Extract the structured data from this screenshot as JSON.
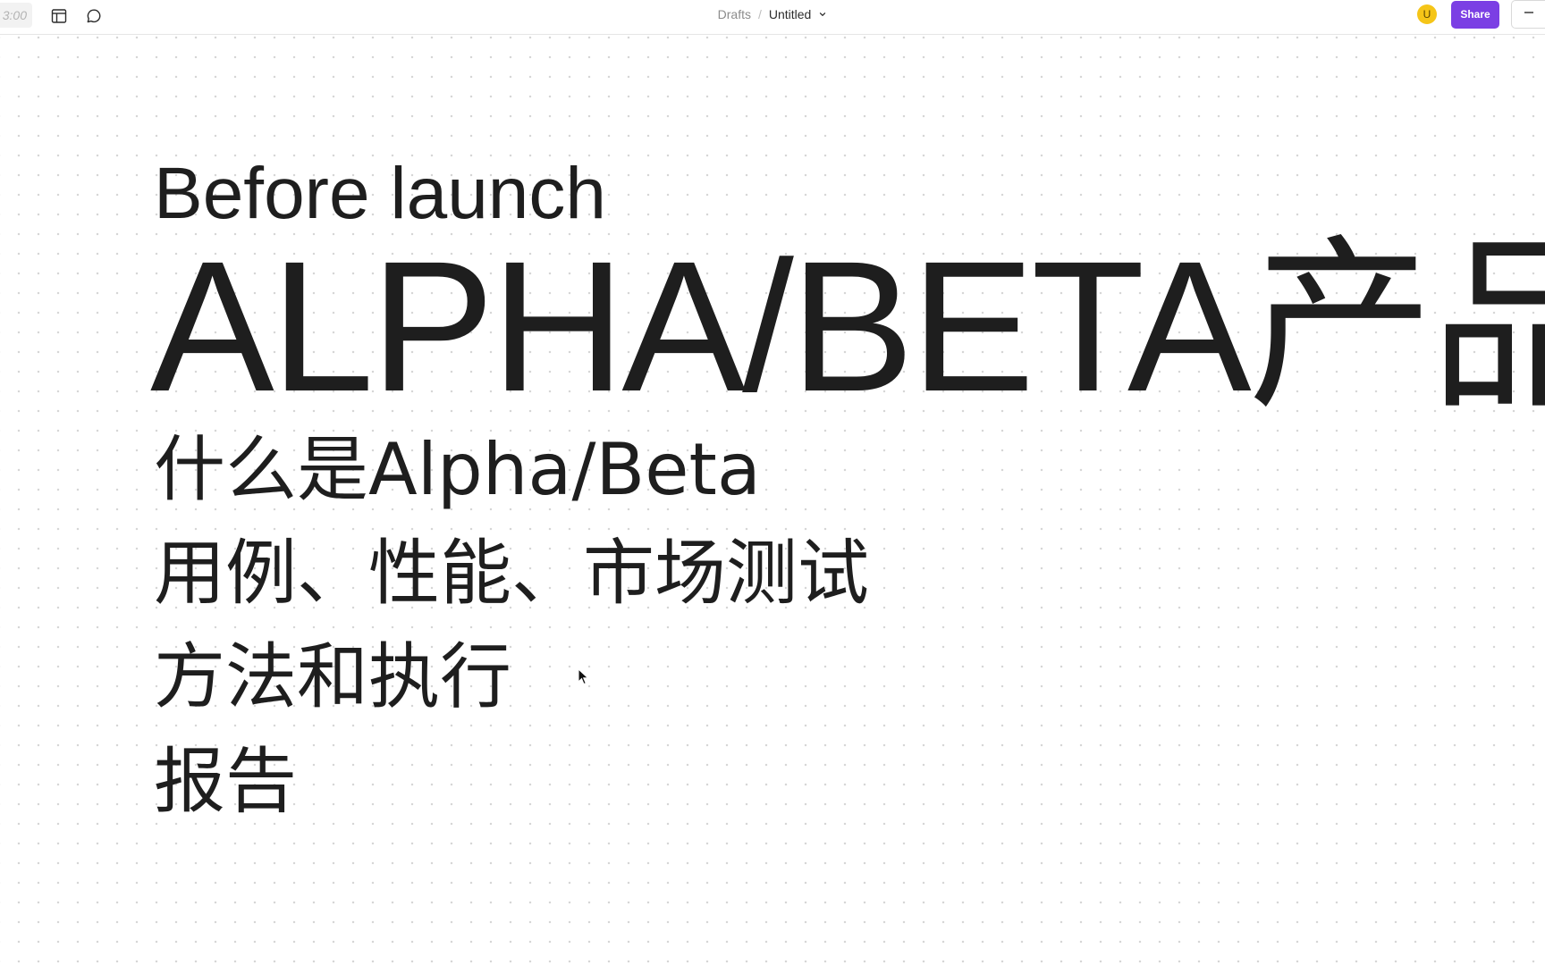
{
  "toolbar": {
    "timer": "3:00",
    "layout_icon": "layout-icon",
    "comment_icon": "comment-icon"
  },
  "breadcrumb": {
    "parent": "Drafts",
    "separator": "/",
    "title": "Untitled",
    "chevron_icon": "chevron-down-icon"
  },
  "user": {
    "avatar_initial": "U",
    "avatar_color": "#f5c518"
  },
  "share": {
    "label": "Share",
    "color": "#7b3fe4"
  },
  "zoom": {
    "icon": "minus-icon"
  },
  "canvas": {
    "heading_small": "Before launch",
    "heading_large": "ALPHA/BETA产品",
    "items": [
      "什么是Alpha/Beta",
      "用例、性能、市场测试",
      "方法和执行",
      "报告"
    ]
  }
}
